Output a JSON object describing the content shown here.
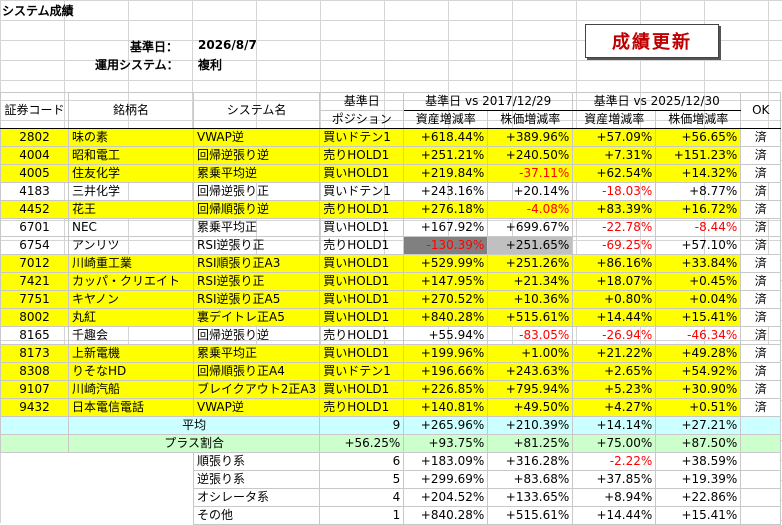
{
  "sheet": {
    "title": "システム成績",
    "date_label": "基準日：",
    "date": "2026/8/7",
    "system_label": "運用システム：",
    "system": "複利"
  },
  "button": "成績更新",
  "headers": {
    "code": "証券コード",
    "name": "銘柄名",
    "system": "システム名",
    "kijunbi": "基準日",
    "position": "ポジション",
    "period1": "基準日 vs 2017/12/29",
    "period2": "基準日 vs 2025/12/30",
    "asset": "資産増減率",
    "price": "株価増減率",
    "ok": "OK"
  },
  "rows": [
    [
      "2802",
      "味の素",
      "VWAP逆",
      "買いドテン1",
      "+618.44%",
      "+389.96%",
      "+57.09%",
      "+56.65%",
      "済"
    ],
    [
      "4004",
      "昭和電工",
      "回帰逆張り逆",
      "売りHOLD1",
      "+251.21%",
      "+240.50%",
      "+7.31%",
      "+151.23%",
      "済"
    ],
    [
      "4005",
      "住友化学",
      "累乗平均逆",
      "買いHOLD1",
      "+219.84%",
      "-37.11%",
      "+62.54%",
      "+14.32%",
      "済"
    ],
    [
      "4183",
      "三井化学",
      "回帰逆張り正",
      "買いドテン1",
      "+243.16%",
      "+20.14%",
      "-18.03%",
      "+8.77%",
      "済"
    ],
    [
      "4452",
      "花王",
      "回帰順張り逆",
      "売りHOLD1",
      "+276.18%",
      "-4.08%",
      "+83.39%",
      "+16.72%",
      "済"
    ],
    [
      "6701",
      "NEC",
      "累乗平均正",
      "買いHOLD1",
      "+167.92%",
      "+699.67%",
      "-22.78%",
      "-8.44%",
      "済"
    ],
    [
      "6754",
      "アンリツ",
      "RSI逆張り正",
      "売りHOLD1",
      "-130.39%",
      "+251.65%",
      "-69.25%",
      "+57.10%",
      "済"
    ],
    [
      "7012",
      "川崎重工業",
      "RSI順張り正A3",
      "買いHOLD1",
      "+529.99%",
      "+251.26%",
      "+86.16%",
      "+33.84%",
      "済"
    ],
    [
      "7421",
      "カッパ・クリエイト",
      "RSI逆張り正",
      "買いHOLD1",
      "+147.95%",
      "+21.34%",
      "+18.07%",
      "+0.45%",
      "済"
    ],
    [
      "7751",
      "キヤノン",
      "RSI逆張り正A5",
      "買いHOLD1",
      "+270.52%",
      "+10.36%",
      "+0.80%",
      "+0.04%",
      "済"
    ],
    [
      "8002",
      "丸紅",
      "裏デイトレ正A5",
      "買いHOLD1",
      "+840.28%",
      "+515.61%",
      "+14.44%",
      "+15.41%",
      "済"
    ],
    [
      "8165",
      "千趣会",
      "回帰逆張り逆",
      "売りHOLD1",
      "+55.94%",
      "-83.05%",
      "-26.94%",
      "-46.34%",
      "済"
    ],
    [
      "8173",
      "上新電機",
      "累乗平均正",
      "買いHOLD1",
      "+199.96%",
      "+1.00%",
      "+21.22%",
      "+49.28%",
      "済"
    ],
    [
      "8308",
      "りそなHD",
      "回帰順張り正A4",
      "買いドテン1",
      "+196.66%",
      "+243.63%",
      "+2.65%",
      "+54.92%",
      "済"
    ],
    [
      "9107",
      "川崎汽船",
      "ブレイクアウト2正A3",
      "買いHOLD1",
      "+226.85%",
      "+795.94%",
      "+5.23%",
      "+30.90%",
      "済"
    ],
    [
      "9432",
      "日本電信電話",
      "VWAP逆",
      "売りHOLD1",
      "+140.81%",
      "+49.50%",
      "+4.27%",
      "+0.51%",
      "済"
    ]
  ],
  "yellow": [
    true,
    true,
    true,
    false,
    true,
    false,
    false,
    true,
    true,
    true,
    true,
    false,
    true,
    true,
    true,
    true
  ],
  "avg": {
    "label": "平均",
    "count": "9",
    "v1": "+265.96%",
    "v2": "+210.39%",
    "v3": "+14.14%",
    "v4": "+27.21%"
  },
  "plus": {
    "label": "プラス割合",
    "v0": "+56.25%",
    "v1": "+93.75%",
    "v2": "+81.25%",
    "v3": "+75.00%",
    "v4": "+87.50%"
  },
  "summary": [
    [
      "順張り系",
      "6",
      "+183.09%",
      "+316.28%",
      "-2.22%",
      "+38.59%"
    ],
    [
      "逆張り系",
      "5",
      "+299.69%",
      "+83.68%",
      "+37.85%",
      "+19.39%"
    ],
    [
      "オシレータ系",
      "4",
      "+204.52%",
      "+133.65%",
      "+8.94%",
      "+22.86%"
    ],
    [
      "その他",
      "1",
      "+840.28%",
      "+515.61%",
      "+14.44%",
      "+15.41%"
    ]
  ]
}
